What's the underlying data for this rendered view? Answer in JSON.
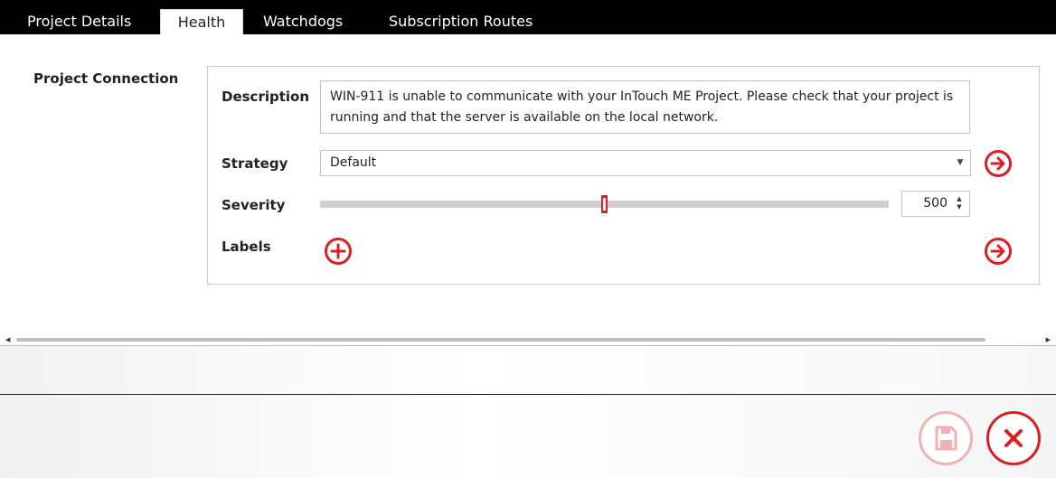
{
  "tabs": [
    {
      "label": "Project Details",
      "active": false
    },
    {
      "label": "Health",
      "active": true
    },
    {
      "label": "Watchdogs",
      "active": false
    },
    {
      "label": "Subscription Routes",
      "active": false
    }
  ],
  "section": {
    "title": "Project Connection"
  },
  "form": {
    "description_label": "Description",
    "description_text": "WIN-911 is unable to communicate with your InTouch ME Project. Please check that your project is running and that the server is available on the local network.",
    "strategy_label": "Strategy",
    "strategy_value": "Default",
    "severity_label": "Severity",
    "severity_value": "500",
    "severity_slider_fraction": 0.5,
    "labels_label": "Labels"
  },
  "icons": {
    "strategy_go": "arrow-right-circle-icon",
    "add_label": "plus-circle-icon",
    "labels_go": "arrow-right-circle-icon",
    "save": "floppy-disk-icon",
    "cancel": "close-icon"
  },
  "colors": {
    "accent": "#d81f26",
    "accent_disabled": "#efb3b5",
    "tabbar": "#000000"
  }
}
